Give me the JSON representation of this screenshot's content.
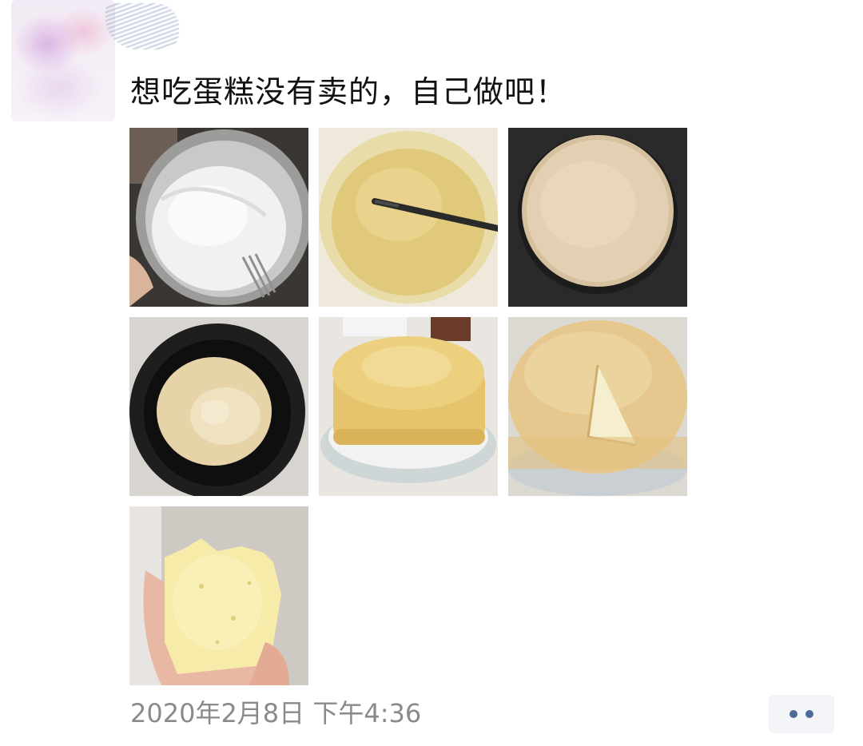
{
  "post": {
    "text": "想吃蛋糕没有卖的，自己做吧！",
    "timestamp": "2020年2月8日 下午4:36"
  },
  "photos": [
    {
      "icon": "whipped-egg-whites-photo"
    },
    {
      "icon": "cake-batter-photo"
    },
    {
      "icon": "batter-in-pot-photo"
    },
    {
      "icon": "cake-rising-in-pot-photo"
    },
    {
      "icon": "whole-cake-on-plate-photo"
    },
    {
      "icon": "sliced-cake-photo"
    },
    {
      "icon": "cake-piece-in-hand-photo"
    }
  ],
  "more_button": {
    "icon": "more-dots-icon"
  },
  "colors": {
    "text": "#111111",
    "timestamp": "#8a8a8a",
    "more_dots": "#4e6b98",
    "more_bg": "#f3f5f8"
  }
}
